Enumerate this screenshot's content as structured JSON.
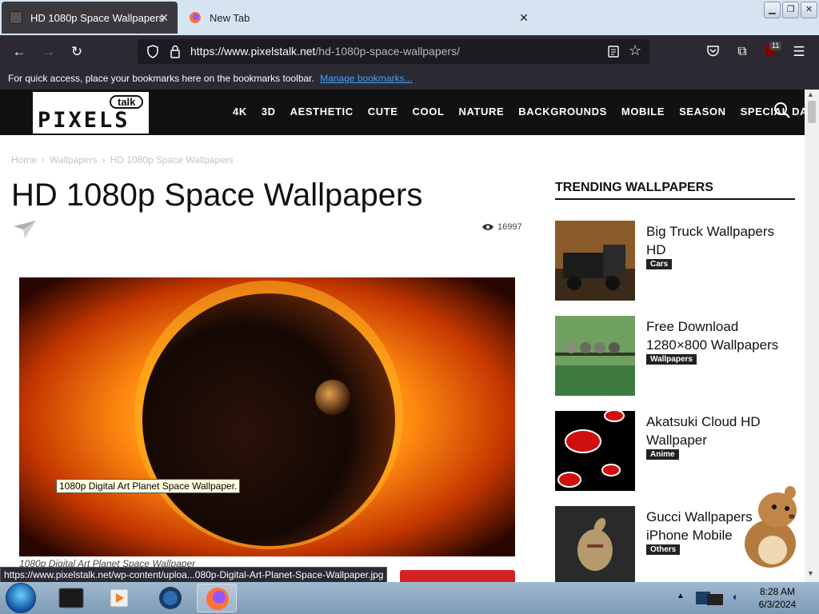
{
  "browser": {
    "tabs": [
      {
        "title": "HD 1080p Space Wallpapers",
        "active": true
      },
      {
        "title": "New Tab",
        "active": false
      }
    ],
    "url_host": "https://www.pixelstalk.net",
    "url_path": "/hd-1080p-space-wallpapers/",
    "extension_badge": "11",
    "bookmarks_text": "For quick access, place your bookmarks here on the bookmarks toolbar.",
    "bookmarks_link": "Manage bookmarks...",
    "status_url": "https://www.pixelstalk.net/wp-content/uploa...080p-Digital-Art-Planet-Space-Wallpaper.jpg"
  },
  "site": {
    "logo_word": "PIXELS",
    "logo_bubble": "talk",
    "menu": [
      "4K",
      "3D",
      "AESTHETIC",
      "CUTE",
      "COOL",
      "NATURE",
      "BACKGROUNDS",
      "MOBILE",
      "SEASON",
      "SPECIAL DAYS"
    ]
  },
  "article": {
    "breadcrumb": [
      "Home",
      "Wallpapers",
      "HD 1080p Space Wallpapers"
    ],
    "title": "HD 1080p Space Wallpapers",
    "views": "16997",
    "image_tooltip": "1080p Digital Art Planet Space Wallpaper.",
    "image_caption": "1080p Digital Art Planet Space Wallpaper"
  },
  "sidebar": {
    "heading": "TRENDING WALLPAPERS",
    "items": [
      {
        "title": "Big Truck Wallpapers HD",
        "category": "Cars"
      },
      {
        "title": "Free Download 1280×800 Wallpapers",
        "category": "Wallpapers"
      },
      {
        "title": "Akatsuki Cloud HD Wallpaper",
        "category": "Anime"
      },
      {
        "title": "Gucci Wallpapers iPhone Mobile",
        "category": "Others"
      }
    ]
  },
  "taskbar": {
    "time": "8:28 AM",
    "date": "6/3/2024"
  },
  "colors": {
    "browser_dark": "#2b2a33",
    "site_header": "#111111",
    "accent_red": "#d32222",
    "link_blue": "#45a1ff"
  }
}
